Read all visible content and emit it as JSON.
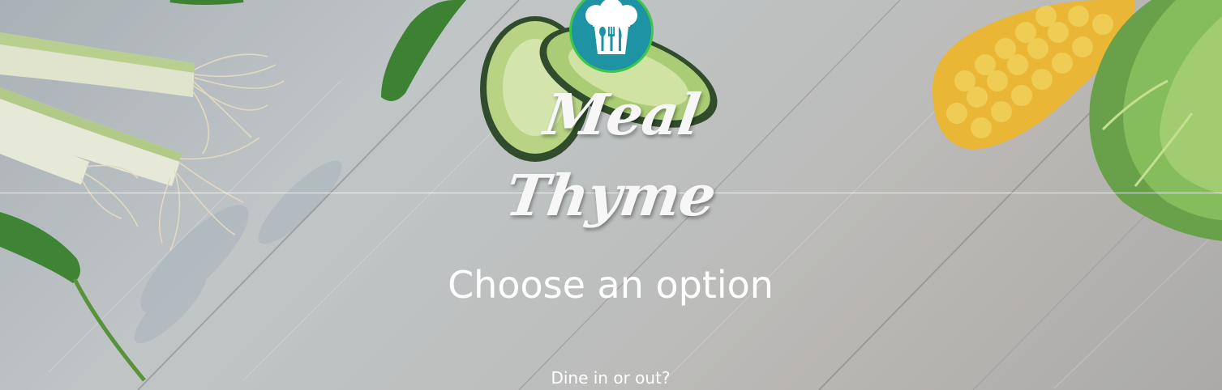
{
  "header": {
    "logo_icon": "chef-hat-utensils-icon",
    "brand_name": "Meal Thyme"
  },
  "main": {
    "title": "Choose an option",
    "prompt": "Dine in or out?"
  },
  "colors": {
    "badge": "#1e93a3",
    "badge_ring": "#3fc54a",
    "text": "#ffffff"
  }
}
